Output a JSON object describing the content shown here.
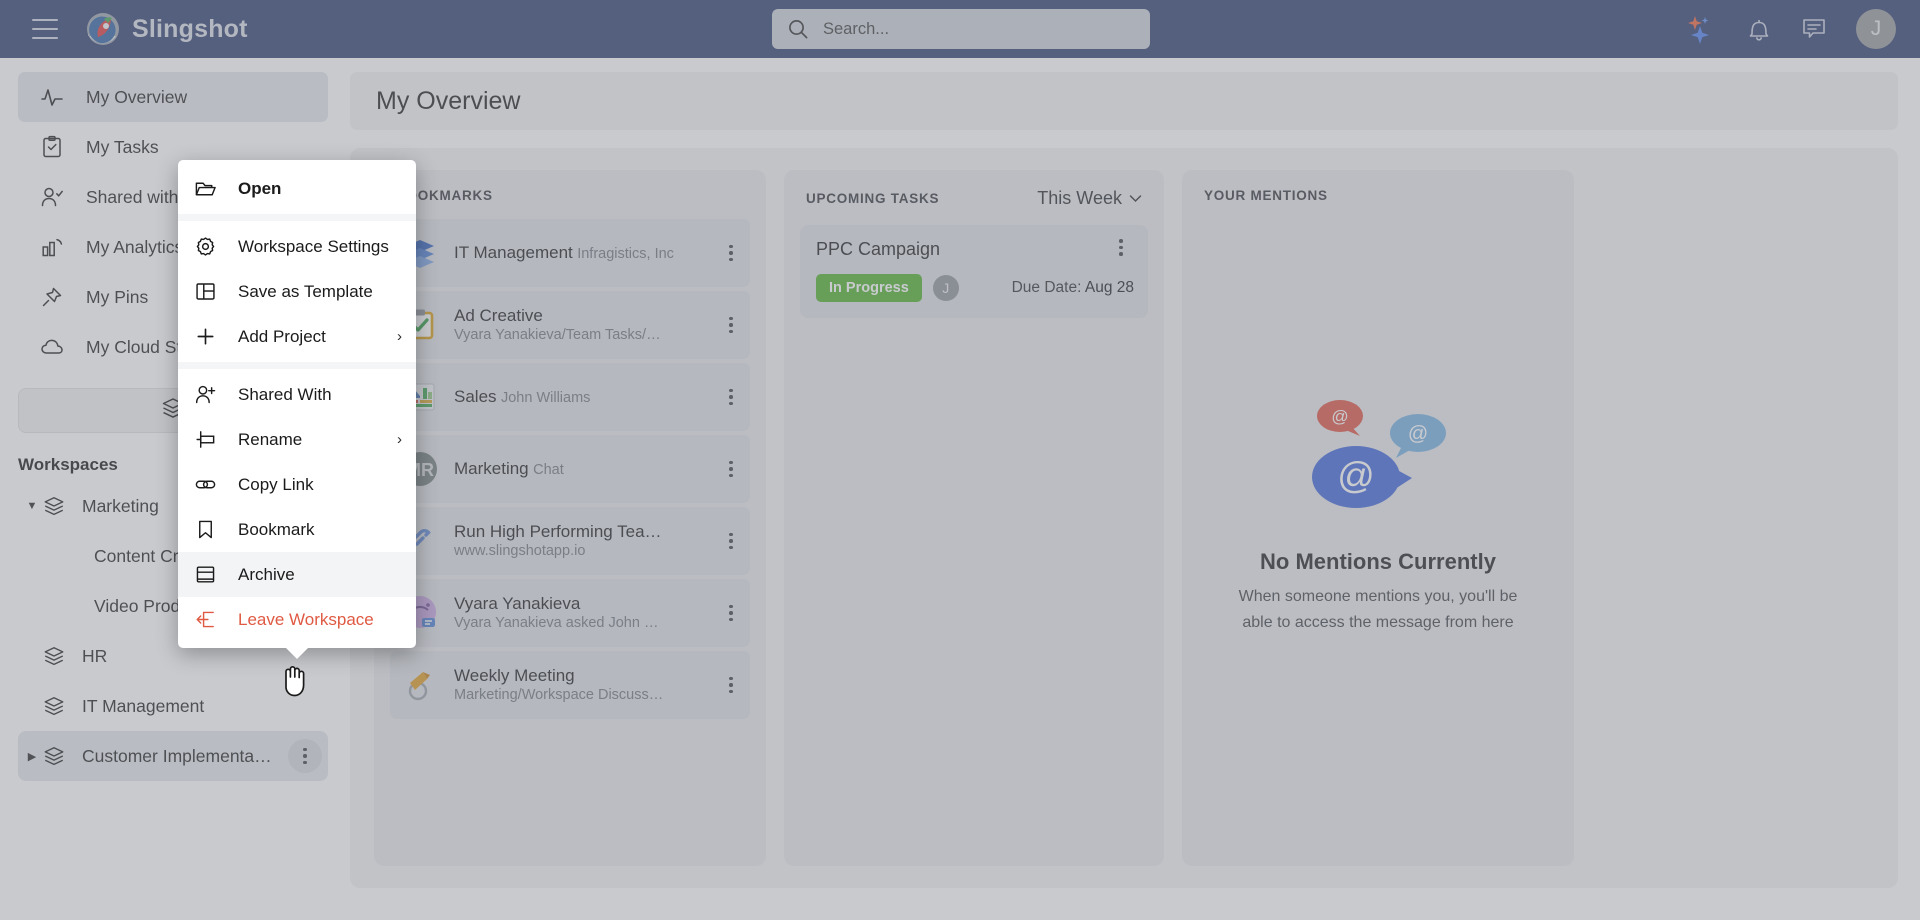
{
  "topbar": {
    "menu_icon": "hamburger-icon",
    "brand": "Slingshot",
    "search_placeholder": "Search...",
    "search_value": "",
    "search_icon": "search-icon",
    "ai_icon": "ai-sparkle-icon",
    "notifications_icon": "bell-icon",
    "messages_icon": "chat-bubble-icon",
    "avatar_initial": "J"
  },
  "sidebar": {
    "nav": [
      {
        "label": "My Overview",
        "icon": "activity-pulse-icon",
        "active": true
      },
      {
        "label": "My Tasks",
        "icon": "clipboard-check-icon",
        "active": false
      },
      {
        "label": "Shared with Me",
        "icon": "user-check-icon",
        "active": false
      },
      {
        "label": "My Analytics",
        "icon": "bar-chart-icon",
        "active": false
      },
      {
        "label": "My Pins",
        "icon": "pin-icon",
        "active": false
      },
      {
        "label": "My Cloud Storage",
        "icon": "cloud-icon",
        "active": false
      }
    ],
    "workspaces_toggle_icon": "stack-layers-icon",
    "workspaces_label": "Workspaces",
    "workspaces": [
      {
        "label": "Marketing",
        "icon": "stack-layers-icon",
        "expanded": true,
        "selected": false
      },
      {
        "label": "Content Creation",
        "child": true
      },
      {
        "label": "Video Production",
        "child": true
      },
      {
        "label": "HR",
        "icon": "stack-layers-icon",
        "expanded": false,
        "selected": false,
        "caret": false
      },
      {
        "label": "IT Management",
        "icon": "stack-layers-icon",
        "expanded": false,
        "selected": false,
        "caret": false
      },
      {
        "label": "Customer Implementa…",
        "icon": "stack-layers-icon",
        "expanded": false,
        "selected": true,
        "caret": true,
        "kebab": "kebab-icon"
      }
    ]
  },
  "page": {
    "title": "My Overview"
  },
  "bookmarks": {
    "title": "BOOKMARKS",
    "items": [
      {
        "title": "IT Management",
        "sub": "Infragistics, Inc",
        "icon": "workspace-stack-icon"
      },
      {
        "title": "Ad Creative",
        "sub": "Vyara Yanakieva/Team Tasks/…",
        "icon": "task-clipboard-icon"
      },
      {
        "title": "Sales",
        "sub": "John Williams",
        "icon": "dashboard-chart-icon"
      },
      {
        "title": "Marketing",
        "sub": "Chat",
        "icon": "chat-avatar-icon"
      },
      {
        "title": "Run High Performing Tea…",
        "sub": "www.slingshotapp.io",
        "icon": "link-icon"
      },
      {
        "title": "Vyara Yanakieva",
        "sub": "Vyara Yanakieva asked John …",
        "icon": "discussion-icon"
      },
      {
        "title": "Weekly Meeting",
        "sub": "Marketing/Workspace Discuss…",
        "icon": "meeting-icon"
      }
    ]
  },
  "upcoming_tasks": {
    "title": "UPCOMING TASKS",
    "filter": "This Week",
    "filter_icon": "chevron-down-icon",
    "items": [
      {
        "name": "PPC Campaign",
        "status": "In Progress",
        "status_color": "#4caf28",
        "assignee_initial": "J",
        "due_label": "Due Date:",
        "due_value": "Aug 28",
        "kebab": "kebab-icon"
      }
    ]
  },
  "mentions": {
    "title": "YOUR MENTIONS",
    "empty_illustration": "at-mention-bubbles-icon",
    "empty_title": "No Mentions Currently",
    "empty_text": "When someone mentions you, you'll be able to access the message from here"
  },
  "context_menu": {
    "items": [
      {
        "label": "Open",
        "icon": "folder-open-icon",
        "bold": true
      },
      {
        "sep": true
      },
      {
        "label": "Workspace Settings",
        "icon": "gear-icon"
      },
      {
        "label": "Save as Template",
        "icon": "template-layout-icon"
      },
      {
        "label": "Add Project",
        "icon": "plus-icon",
        "arrow": "›"
      },
      {
        "sep": true
      },
      {
        "label": "Shared With",
        "icon": "user-plus-icon"
      },
      {
        "label": "Rename",
        "icon": "rename-icon",
        "arrow": "›"
      },
      {
        "label": "Copy Link",
        "icon": "link-chain-icon"
      },
      {
        "label": "Bookmark",
        "icon": "bookmark-icon"
      },
      {
        "label": "Archive",
        "icon": "archive-box-icon",
        "hover": true
      },
      {
        "label": "Leave Workspace",
        "icon": "leave-exit-icon",
        "danger": true
      }
    ]
  },
  "colors": {
    "topbar": "#2b3a6b",
    "accent_green": "#4caf28",
    "danger_red": "#e05a43",
    "sidebar_active": "#e4e6ea"
  }
}
